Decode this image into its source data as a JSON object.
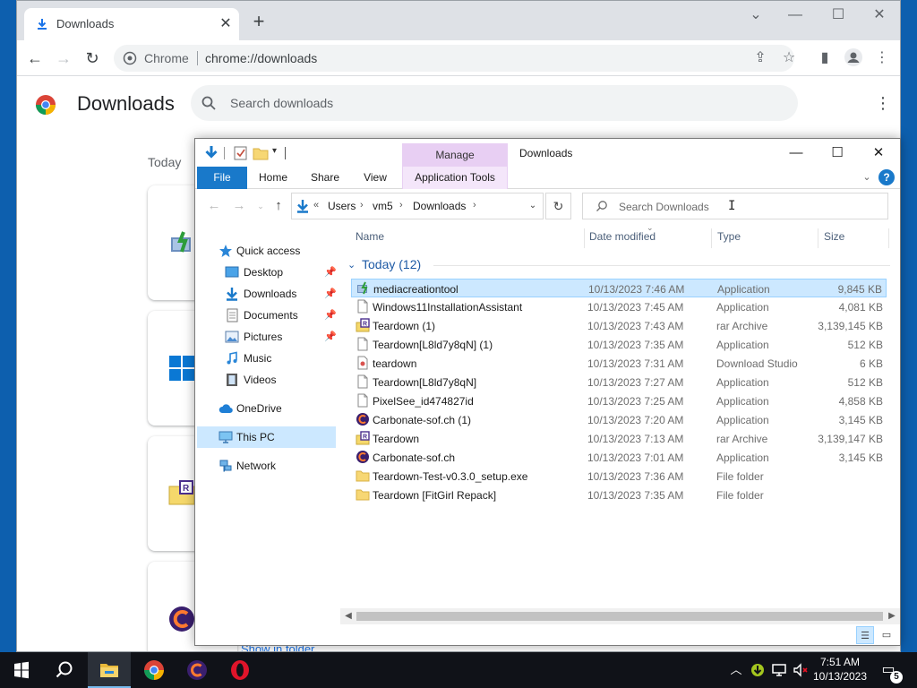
{
  "chrome": {
    "tab_title": "Downloads",
    "tab_close": "✕",
    "new_tab": "+",
    "omnibox_site": "Chrome",
    "omnibox_url": "chrome://downloads",
    "page_title": "Downloads",
    "search_placeholder": "Search downloads",
    "date_group": "Today",
    "show_in_folder": "Show in folder"
  },
  "explorer": {
    "window_title": "Downloads",
    "manage_label": "Manage",
    "ribbon_tabs": [
      "File",
      "Home",
      "Share",
      "View",
      "Application Tools"
    ],
    "address": {
      "overflow": "«",
      "crumbs": [
        "Users",
        "vm5",
        "Downloads"
      ]
    },
    "search_placeholder": "Search Downloads",
    "nav": [
      {
        "label": "Quick access",
        "icon": "star-icon"
      },
      {
        "label": "Desktop",
        "icon": "desktop-folder-icon",
        "pinned": true
      },
      {
        "label": "Downloads",
        "icon": "downloads-folder-icon",
        "pinned": true
      },
      {
        "label": "Documents",
        "icon": "documents-folder-icon",
        "pinned": true
      },
      {
        "label": "Pictures",
        "icon": "pictures-folder-icon",
        "pinned": true
      },
      {
        "label": "Music",
        "icon": "music-folder-icon"
      },
      {
        "label": "Videos",
        "icon": "videos-folder-icon"
      },
      {
        "label": "OneDrive",
        "icon": "onedrive-cloud-icon"
      },
      {
        "label": "This PC",
        "icon": "computer-icon",
        "selected": true
      },
      {
        "label": "Network",
        "icon": "network-icon"
      }
    ],
    "columns": {
      "name": "Name",
      "date": "Date modified",
      "type": "Type",
      "size": "Size"
    },
    "group_label": "Today (12)",
    "files": [
      {
        "name": "mediacreationtool",
        "date": "10/13/2023 7:46 AM",
        "type": "Application",
        "size": "9,845 KB",
        "icon": "installer-icon",
        "selected": true
      },
      {
        "name": "Windows11InstallationAssistant",
        "date": "10/13/2023 7:45 AM",
        "type": "Application",
        "size": "4,081 KB",
        "icon": "blank-file-icon"
      },
      {
        "name": "Teardown (1)",
        "date": "10/13/2023 7:43 AM",
        "type": "rar Archive",
        "size": "3,139,145 KB",
        "icon": "rar-archive-icon"
      },
      {
        "name": "Teardown[L8ld7y8qN] (1)",
        "date": "10/13/2023 7:35 AM",
        "type": "Application",
        "size": "512 KB",
        "icon": "blank-file-icon"
      },
      {
        "name": "teardown",
        "date": "10/13/2023 7:31 AM",
        "type": "Download Studio",
        "size": "6 KB",
        "icon": "download-studio-file-icon"
      },
      {
        "name": "Teardown[L8ld7y8qN]",
        "date": "10/13/2023 7:27 AM",
        "type": "Application",
        "size": "512 KB",
        "icon": "blank-file-icon"
      },
      {
        "name": "PixelSee_id474827id",
        "date": "10/13/2023 7:25 AM",
        "type": "Application",
        "size": "4,858 KB",
        "icon": "blank-file-icon"
      },
      {
        "name": "Carbonate-sof.ch (1)",
        "date": "10/13/2023 7:20 AM",
        "type": "Application",
        "size": "3,145 KB",
        "icon": "carbonate-app-icon"
      },
      {
        "name": "Teardown",
        "date": "10/13/2023 7:13 AM",
        "type": "rar Archive",
        "size": "3,139,147 KB",
        "icon": "rar-archive-icon"
      },
      {
        "name": "Carbonate-sof.ch",
        "date": "10/13/2023 7:01 AM",
        "type": "Application",
        "size": "3,145 KB",
        "icon": "carbonate-app-icon"
      },
      {
        "name": "Teardown-Test-v0.3.0_setup.exe",
        "date": "10/13/2023 7:36 AM",
        "type": "File folder",
        "size": "",
        "icon": "folder-icon"
      },
      {
        "name": "Teardown [FitGirl Repack]",
        "date": "10/13/2023 7:35 AM",
        "type": "File folder",
        "size": "",
        "icon": "folder-icon"
      }
    ]
  },
  "taskbar": {
    "time": "7:51 AM",
    "date": "10/13/2023",
    "notification_count": "5",
    "apps": [
      "start-icon",
      "search-icon",
      "file-explorer-icon",
      "chrome-icon",
      "carbonate-icon",
      "opera-icon"
    ]
  },
  "colors": {
    "accent": "#1979ca",
    "selection": "#cce8ff",
    "manage_tab": "#e8cff3",
    "desktop": "#0f4a86"
  }
}
